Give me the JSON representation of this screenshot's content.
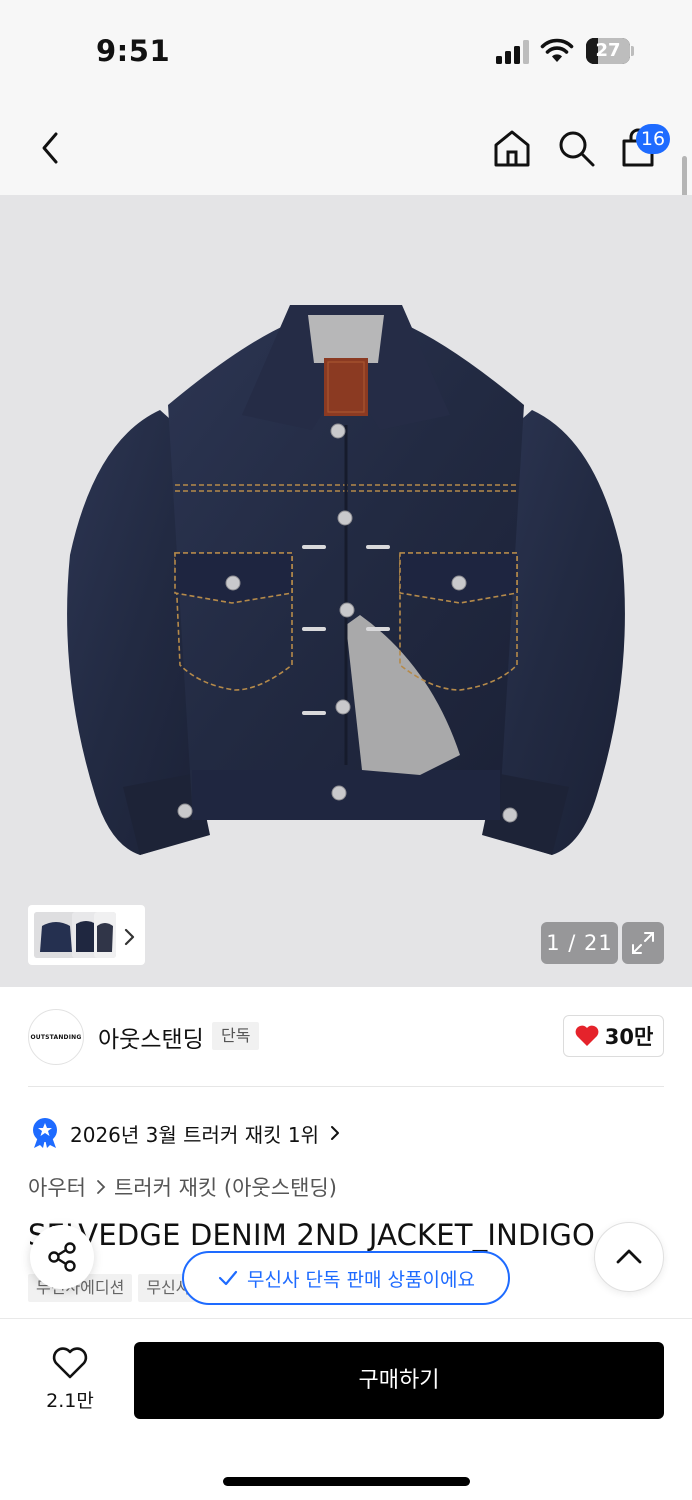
{
  "status_bar": {
    "time": "9:51",
    "battery_percent": "27",
    "battery_level": 0.27
  },
  "header": {
    "icons": [
      "back-arrow-icon",
      "home-icon",
      "search-icon",
      "shopping-bag-icon"
    ],
    "cart_count": "16"
  },
  "gallery": {
    "counter": "1 / 21",
    "current_image": 1,
    "total_images": 21,
    "thumbnail_count": 3
  },
  "brand": {
    "logo_text": "OUTSTANDING",
    "name": "아웃스탠딩",
    "tag": "단독",
    "like_count": "30만"
  },
  "ranking": {
    "text": "2026년 3월 트러커 재킷 1위"
  },
  "breadcrumb": {
    "items": [
      "아우터",
      "트러커 재킷 (아웃스탠딩)"
    ]
  },
  "product": {
    "title": "SELVEDGE DENIM 2ND JACKET_INDIGO",
    "chips": [
      "무신사에디션",
      "무신사"
    ]
  },
  "toast": {
    "text": "무신사 단독 판매 상품이에요"
  },
  "bottom_bar": {
    "wish_count": "2.1만",
    "buy_label": "구매하기"
  },
  "colors": {
    "accent_blue": "#1e6bff",
    "like_red": "#e5232b",
    "buy_button": "#000000"
  }
}
